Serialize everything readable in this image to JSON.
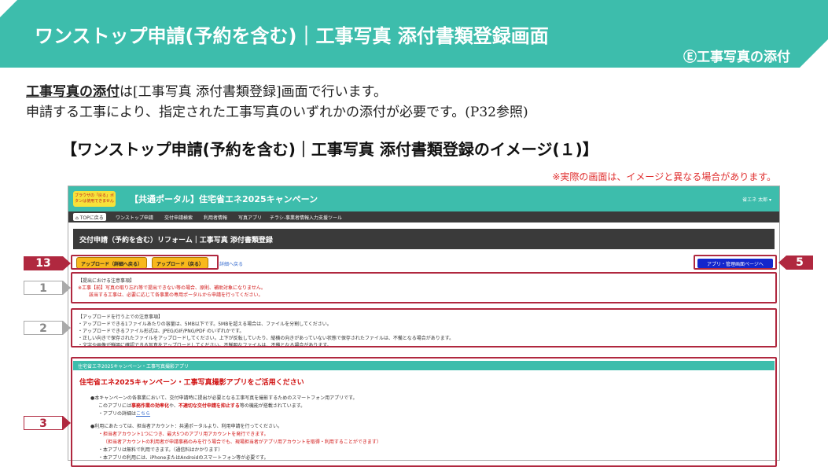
{
  "header": {
    "title": "ワンストップ申請(予約を含む)｜工事写真 添付書類登録画面",
    "section": "Ⓔ工事写真の添付"
  },
  "intro": {
    "strong": "工事写真の添付",
    "line1_rest": "は[工事写真 添付書類登録]画面で行います。",
    "line2": "申請する工事により、指定された工事写真のいずれかの添付が必要です。(P32参照)"
  },
  "image_title": "【ワンストップ申請(予約を含む)｜工事写真 添付書類登録のイメージ(１)】",
  "disclaimer": "※実際の画面は、イメージと異なる場合があります。",
  "screen": {
    "badge_text": "ブラウザの「戻る」ボタンは使用できません",
    "portal_title": "【共通ポータル】住宅省エネ2025キャンペーン",
    "user": "省エネ 太郎 ▾",
    "nav": {
      "top": "TOPに戻る",
      "items": [
        "ワンストップ申請",
        "交付申請検索",
        "利用者情報",
        "写真アプリ",
        "チラシ-事業者情報入力支援ツール"
      ]
    },
    "page_heading": "交付申請（予約を含む）リフォーム｜工事写真 添付書類登録",
    "buttons": {
      "upload_detail": "アップロード（詳細へ戻る）",
      "upload_back": "アップロード（戻る）",
      "back_link": "詳細へ戻る",
      "app_admin": "アプリ・管理画面ページへ"
    },
    "notice1": {
      "heading": "【提出における注意事項】",
      "line1": "※工事【前】写真の取り忘れ等で提出できない等の場合、原則、補助対象になりません。",
      "line2": "該当する工事は、必要に応じて各事業の専用ポータルから申請を行ってください。"
    },
    "notice2": {
      "heading": "【アップロードを行う上での注意事項】",
      "lines": [
        "・アップロードできる1ファイルあたりの容量は、5MB以下です。5MBを超える場合は、ファイルを分割してください。",
        "・アップロードできるファイル形式は、JPEG/GIF/PNG/PDF のいずれかです。",
        "・正しい向きで保存されたファイルをアップロードしてください。上下が反転していたり、縦横の向きがあっていない状態で保存されたファイルは、不備となる場合があります。",
        "・文字や画像が鮮明に確認できる写真をアップロードしてください。不鮮明なファイルは、不備となる場合があります。"
      ]
    },
    "app": {
      "bar": "住宅省エネ2025キャンペーン・工事写真撮影アプリ",
      "title": "住宅省エネ2025キャンペーン・工事写真撮影アプリをご活用ください",
      "p1": "●本キャンペーンの各事業において、交付申請時に提出が必要となる工事写真を撮影するためのスマートフォン用アプリです。",
      "p2_pre": "このアプリには",
      "p2_b1": "事務作業の効率化",
      "p2_mid": "や、",
      "p2_b2": "不適切な交付申請を抑止する",
      "p2_post": "等の機能が搭載されています。",
      "p3_pre": "・アプリの詳細は",
      "p3_link": "こちら",
      "p4": "●利用にあたっては、担当者アカウント：共通ポータルより、利用申請を行ってください。",
      "p5": "・担当者アカウント1つにつき、最大5つのアプリ用アカウントを発行できます。",
      "p6": "（担当者アカウントの利用者が申請事務のみを行う場合でも、現場担当者がアプリ用アカウントを取得・利用することができます）",
      "p7": "・本アプリは無料で利用できます。（通信料はかかります）",
      "p8": "・本アプリの利用には、iPhoneまたはAndroidのスマートフォン等が必要です。"
    }
  },
  "tags": {
    "t13": "13",
    "t1": "1",
    "t2": "2",
    "t3": "3",
    "t5": "5"
  }
}
